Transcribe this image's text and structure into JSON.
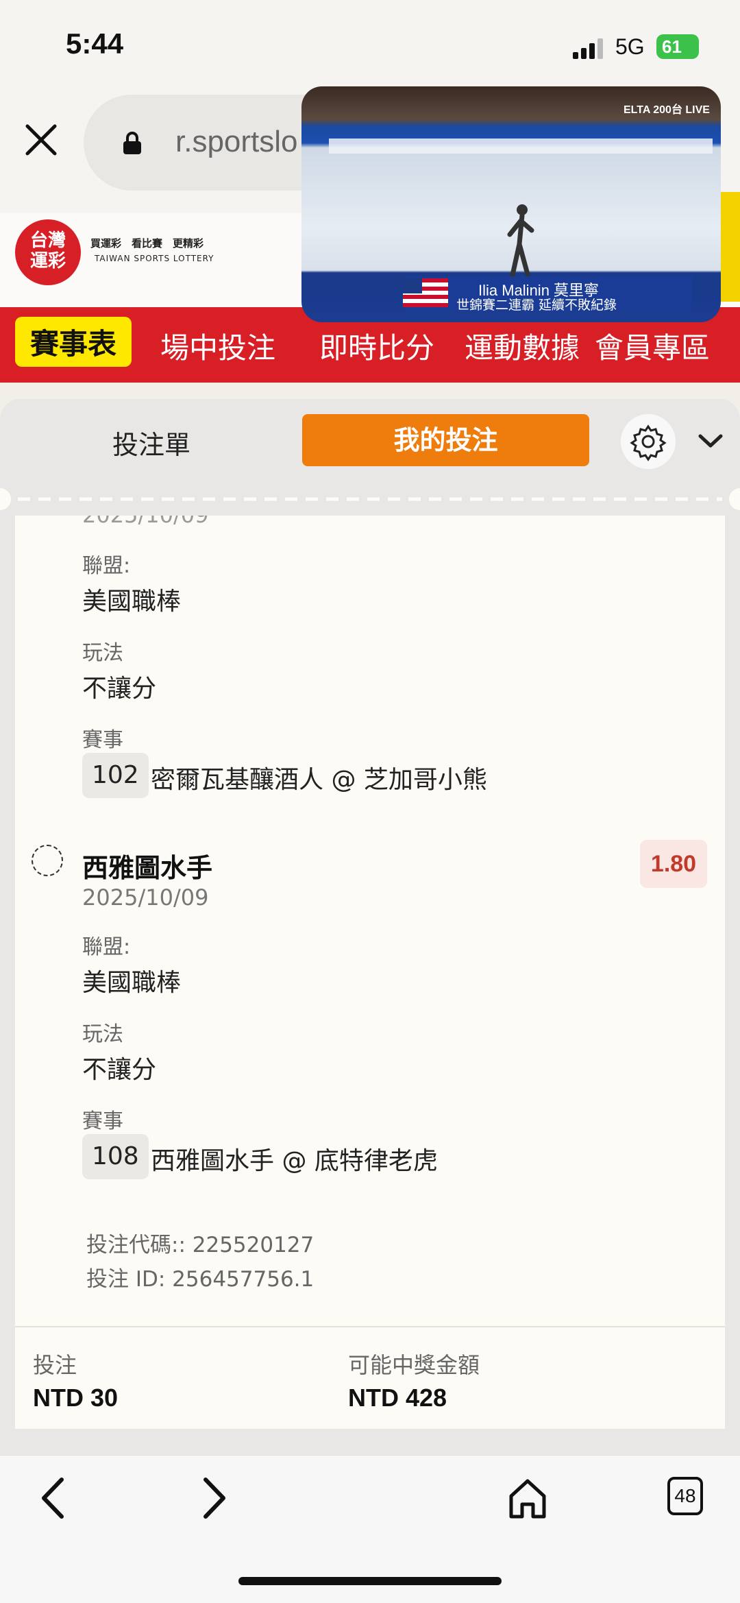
{
  "status_bar": {
    "time": "5:44",
    "network": "5G",
    "battery": "61"
  },
  "browser": {
    "url": "r.sportslo",
    "tab_count": "48"
  },
  "brand": {
    "logo_text": "台灣運彩",
    "slogan": "買運彩　看比賽　更精彩",
    "subtitle": "TAIWAN SPORTS LOTTERY"
  },
  "nav": {
    "items": [
      "賽事表",
      "場中投注",
      "即時比分",
      "運動數據",
      "會員專區"
    ]
  },
  "video": {
    "channel": "ELTA 200台 LIVE",
    "name_line": "Ilia Malinin 莫里寧",
    "caption_line": "世錦賽二連霸 延續不敗紀錄"
  },
  "panel": {
    "tab_betslip": "投注單",
    "tab_mybets": "我的投注"
  },
  "bets": [
    {
      "date_partial": "2025/10/09",
      "league_label": "聯盟:",
      "league": "美國職棒",
      "play_label": "玩法",
      "play": "不讓分",
      "event_label": "賽事",
      "event_no": "102",
      "event": "密爾瓦基釀酒人 @ 芝加哥小熊"
    },
    {
      "team": "西雅圖水手",
      "date": "2025/10/09",
      "odds": "1.80",
      "league_label": "聯盟:",
      "league": "美國職棒",
      "play_label": "玩法",
      "play": "不讓分",
      "event_label": "賽事",
      "event_no": "108",
      "event": "西雅圖水手 @ 底特律老虎"
    }
  ],
  "bet_code": "投注代碼:: 225520127",
  "bet_id": "投注 ID: 256457756.1",
  "footer": {
    "stake_label": "投注",
    "stake": "NTD 30",
    "payout_label": "可能中獎金額",
    "payout": "NTD 428"
  }
}
